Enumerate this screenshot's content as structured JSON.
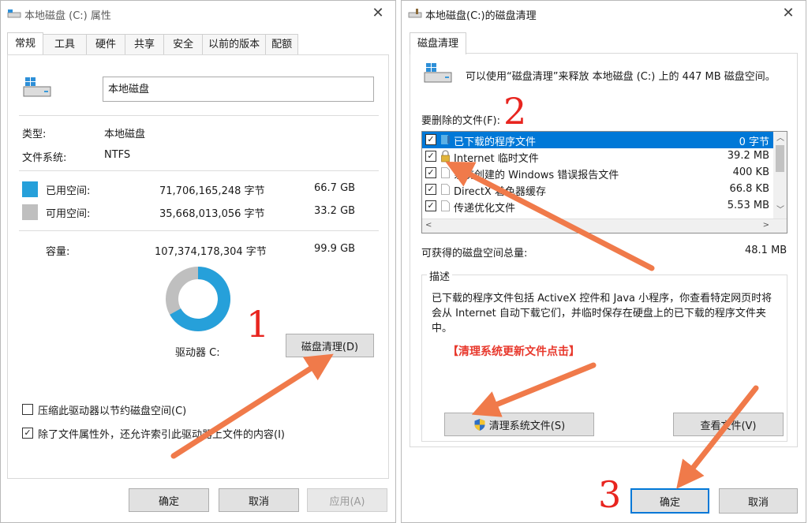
{
  "left_window": {
    "title": "本地磁盘 (C:) 属性",
    "close": "✕",
    "tabs": [
      "常规",
      "工具",
      "硬件",
      "共享",
      "安全",
      "以前的版本",
      "配额"
    ],
    "drive_name": "本地磁盘",
    "type_label": "类型:",
    "type_value": "本地磁盘",
    "fs_label": "文件系统:",
    "fs_value": "NTFS",
    "used_label": "已用空间:",
    "used_bytes": "71,706,165,248 字节",
    "used_size": "66.7 GB",
    "free_label": "可用空间:",
    "free_bytes": "35,668,013,056 字节",
    "free_size": "33.2 GB",
    "capacity_label": "容量:",
    "capacity_bytes": "107,374,178,304 字节",
    "capacity_size": "99.9 GB",
    "drive_label": "驱动器 C:",
    "cleanup_button": "磁盘清理(D)",
    "compress_label": "压缩此驱动器以节约磁盘空间(C)",
    "index_label": "除了文件属性外，还允许索引此驱动器上文件的内容(I)",
    "ok": "确定",
    "cancel": "取消",
    "apply": "应用(A)",
    "used_fraction": 0.668,
    "used_color": "#26a0da",
    "free_color": "#bfbfbf"
  },
  "right_window": {
    "title": "本地磁盘(C:)的磁盘清理",
    "close": "✕",
    "tab": "磁盘清理",
    "intro": "可以使用“磁盘清理”来释放 本地磁盘 (C:) 上的 447 MB 磁盘空间。",
    "files_label": "要删除的文件(F):",
    "files": [
      {
        "name": "已下载的程序文件",
        "size": "0 字节",
        "checked": true,
        "selected": true
      },
      {
        "name": "Internet 临时文件",
        "size": "39.2 MB",
        "checked": true,
        "selected": false
      },
      {
        "name": "系统创建的 Windows 错误报告文件",
        "size": "400 KB",
        "checked": true,
        "selected": false
      },
      {
        "name": "DirectX 着色器缓存",
        "size": "66.8 KB",
        "checked": true,
        "selected": false
      },
      {
        "name": "传递优化文件",
        "size": "5.53 MB",
        "checked": true,
        "selected": false
      }
    ],
    "total_label": "可获得的磁盘空间总量:",
    "total_value": "48.1 MB",
    "desc_legend": "描述",
    "desc_text": "已下载的程序文件包括 ActiveX 控件和 Java 小程序，你查看特定网页时将会从 Internet 自动下载它们，并临时保存在硬盘上的已下载的程序文件夹中。",
    "clean_system_button": "清理系统文件(S)",
    "view_files_button": "查看文件(V)",
    "ok": "确定",
    "cancel": "取消"
  },
  "annotations": {
    "step1": "1",
    "step2": "2",
    "step3": "3",
    "hint": "【清理系统更新文件点击】",
    "arrow_color": "#f07a4a"
  }
}
